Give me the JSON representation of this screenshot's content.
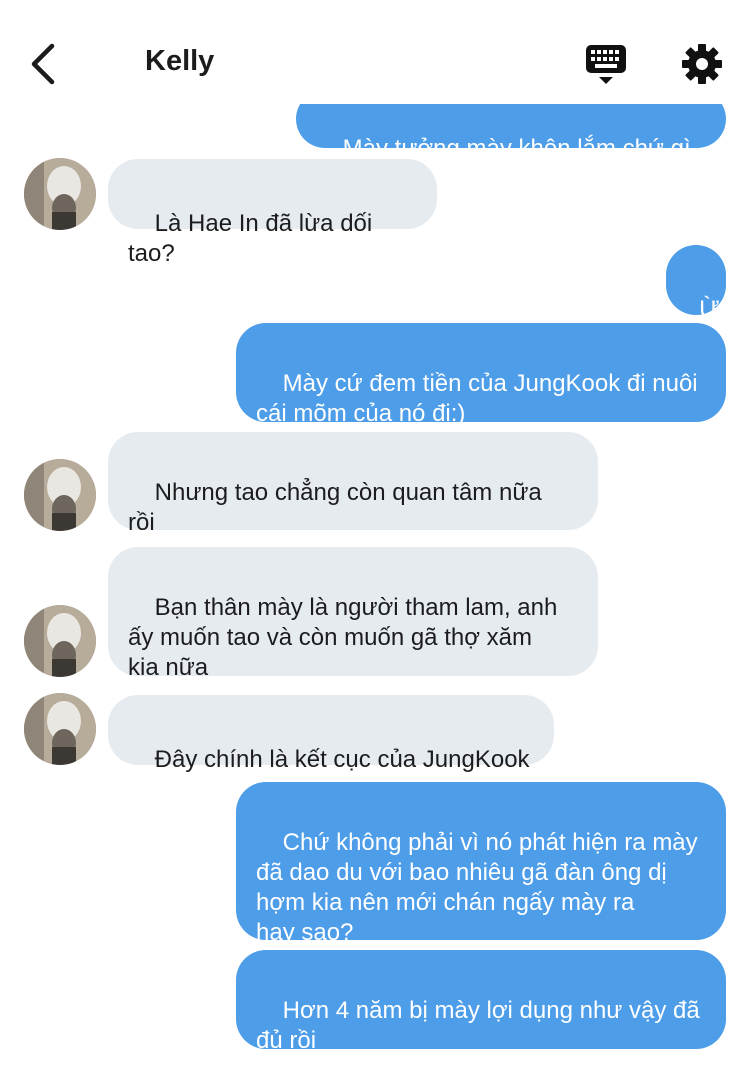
{
  "header": {
    "title": "Kelly",
    "back_icon": "chevron-left-icon",
    "keyboard_icon": "keyboard-icon",
    "settings_icon": "gear-icon"
  },
  "colors": {
    "sent_bubble": "#4d9de9",
    "received_bubble": "#e6ebf0"
  },
  "messages": [
    {
      "side": "sent",
      "text": "Mày tưởng mày khôn lắm chứ gì"
    },
    {
      "side": "received",
      "text": "Là Hae In đã lừa dối tao?"
    },
    {
      "side": "sent",
      "text": "Ừ"
    },
    {
      "side": "sent",
      "text": "Mày cứ đem tiền của JungKook đi nuôi\ncái mõm của nó đi:)"
    },
    {
      "side": "received",
      "text": "Nhưng tao chẳng còn quan tâm nữa\nrồi"
    },
    {
      "side": "received",
      "text": "Bạn thân mày là người tham lam, anh\nấy muốn tao và còn muốn gã thợ xăm\nkia nữa"
    },
    {
      "side": "received",
      "text": "Đây chính là kết cục của JungKook"
    },
    {
      "side": "sent",
      "text": "Chứ không phải vì nó phát hiện ra mày\nđã dao du với bao nhiêu gã đàn ông dị\nhợm kia nên mới chán ngấy mày ra\nhay sao?"
    },
    {
      "side": "sent",
      "text": "Hơn 4 năm bị mày lợi dụng như vậy đã\nđủ rồi"
    }
  ]
}
